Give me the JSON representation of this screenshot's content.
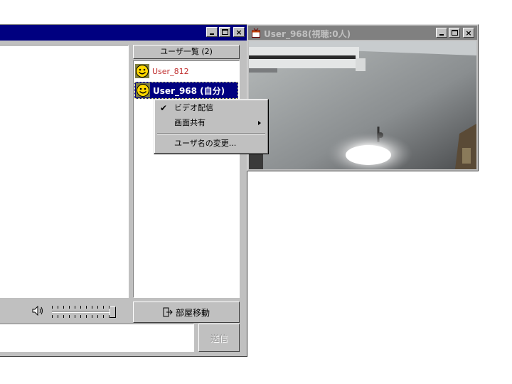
{
  "main_window": {
    "users_header": "ユーザ一覧 (2)",
    "users": [
      {
        "name": "User_812",
        "icon": "smiley-icon",
        "selected": false
      },
      {
        "name": "User_968 (自分)",
        "icon": "smiley-icon",
        "selected": true
      }
    ],
    "move_room_label": "部屋移動",
    "send_label": "送信",
    "volume_level": 1.0,
    "message_input_value": ""
  },
  "video_window": {
    "title": "User_968(視聴:0人)"
  },
  "context_menu": {
    "items": [
      {
        "label": "ビデオ配信",
        "checked": true,
        "submenu": false
      },
      {
        "label": "画面共有",
        "checked": false,
        "submenu": true
      },
      {
        "label": "ユーザ名の変更...",
        "checked": false,
        "submenu": false
      }
    ],
    "check_glyph": "✔"
  },
  "colors": {
    "active_title": "#000080",
    "inactive_title": "#808080",
    "face": "#c0c0c0",
    "other_user_name": "#c03030",
    "selection": "#000080"
  }
}
